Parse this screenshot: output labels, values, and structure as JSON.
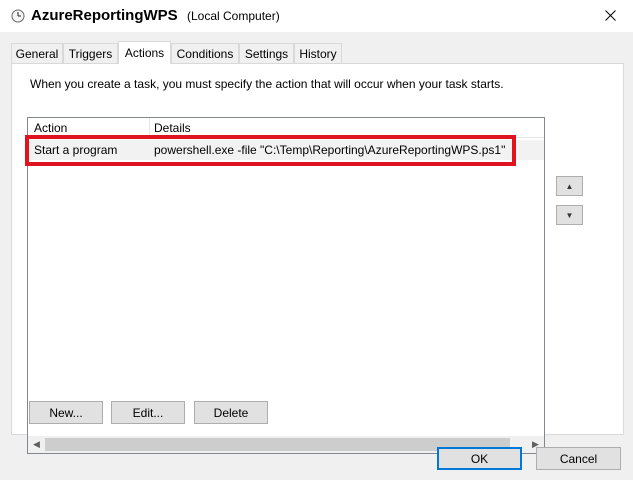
{
  "titlebar": {
    "icon": "clock-icon",
    "task_name": "AzureReportingWPS",
    "location": "(Local Computer)",
    "close_icon": "close-icon"
  },
  "tabs": [
    {
      "label": "General",
      "active": false
    },
    {
      "label": "Triggers",
      "active": false
    },
    {
      "label": "Actions",
      "active": true
    },
    {
      "label": "Conditions",
      "active": false
    },
    {
      "label": "Settings",
      "active": false
    },
    {
      "label": "History",
      "active": false
    }
  ],
  "actions_panel": {
    "description": "When you create a task, you must specify the action that will occur when your task starts.",
    "columns": [
      "Action",
      "Details"
    ],
    "rows": [
      {
        "action": "Start a program",
        "details": "powershell.exe -file \"C:\\Temp\\Reporting\\AzureReportingWPS.ps1\""
      }
    ],
    "move_up_icon": "triangle-up-icon",
    "move_down_icon": "triangle-down-icon",
    "buttons": {
      "new": "New...",
      "edit": "Edit...",
      "delete": "Delete"
    }
  },
  "dialog_buttons": {
    "ok": "OK",
    "cancel": "Cancel"
  },
  "colors": {
    "highlight_box": "#e0141e",
    "default_button_border": "#0078d7"
  }
}
